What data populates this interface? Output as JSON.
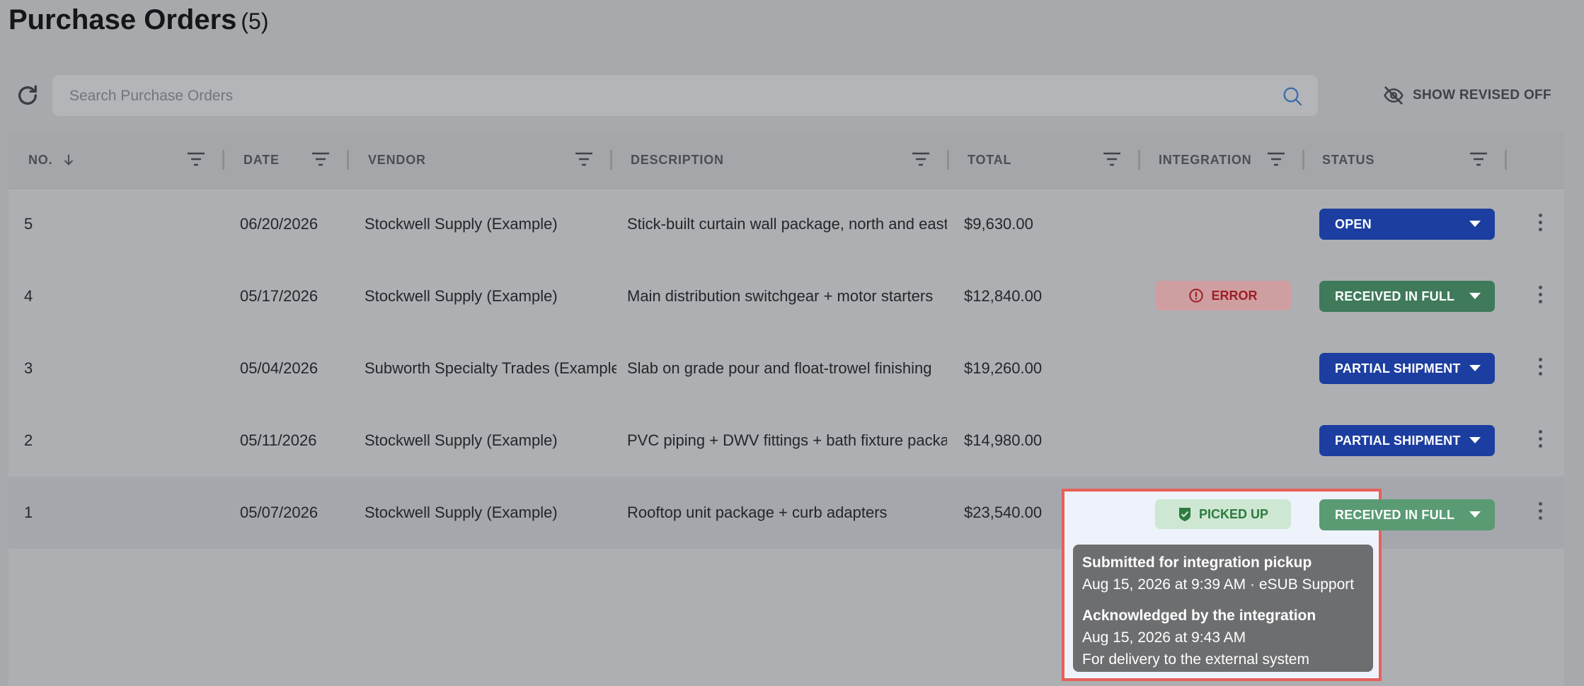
{
  "page": {
    "title": "Purchase Orders",
    "count": "(5)"
  },
  "toolbar": {
    "search_placeholder": "Search Purchase Orders",
    "show_revised_label": "SHOW REVISED OFF"
  },
  "columns": {
    "no": "NO.",
    "date": "DATE",
    "vendor": "VENDOR",
    "description": "DESCRIPTION",
    "total": "TOTAL",
    "integration": "INTEGRATION",
    "status": "STATUS"
  },
  "rows": [
    {
      "no": "5",
      "date": "06/20/2026",
      "vendor": "Stockwell Supply (Example)",
      "description": "Stick-built curtain wall package, north and east elevations",
      "total": "$9,630.00",
      "integration": "",
      "status": "OPEN"
    },
    {
      "no": "4",
      "date": "05/17/2026",
      "vendor": "Stockwell Supply (Example)",
      "description": "Main distribution switchgear + motor starters",
      "total": "$12,840.00",
      "integration": "ERROR",
      "status": "RECEIVED IN FULL"
    },
    {
      "no": "3",
      "date": "05/04/2026",
      "vendor": "Subworth Specialty Trades (Example)",
      "description": "Slab on grade pour and float-trowel finishing",
      "total": "$19,260.00",
      "integration": "",
      "status": "PARTIAL SHIPMENT"
    },
    {
      "no": "2",
      "date": "05/11/2026",
      "vendor": "Stockwell Supply (Example)",
      "description": "PVC piping + DWV fittings + bath fixture package",
      "total": "$14,980.00",
      "integration": "",
      "status": "PARTIAL SHIPMENT"
    },
    {
      "no": "1",
      "date": "05/07/2026",
      "vendor": "Stockwell Supply (Example)",
      "description": "Rooftop unit package + curb adapters",
      "total": "$23,540.00",
      "integration": "PICKED UP",
      "status": "RECEIVED IN FULL"
    }
  ],
  "tooltip": {
    "submitted_title": "Submitted for integration pickup",
    "submitted_detail": "Aug 15, 2026 at 9:39 AM · eSUB Support",
    "ack_title": "Acknowledged by the integration",
    "ack_time": "Aug 15, 2026 at 9:43 AM",
    "ack_note": "For delivery to the external system"
  },
  "colors": {
    "status_blue": "#1c3ea0",
    "status_green": "#3f7a5a",
    "error_badge": "#cf9ea1",
    "picked_badge": "#cde7d3",
    "highlight_border": "#e8605a"
  }
}
